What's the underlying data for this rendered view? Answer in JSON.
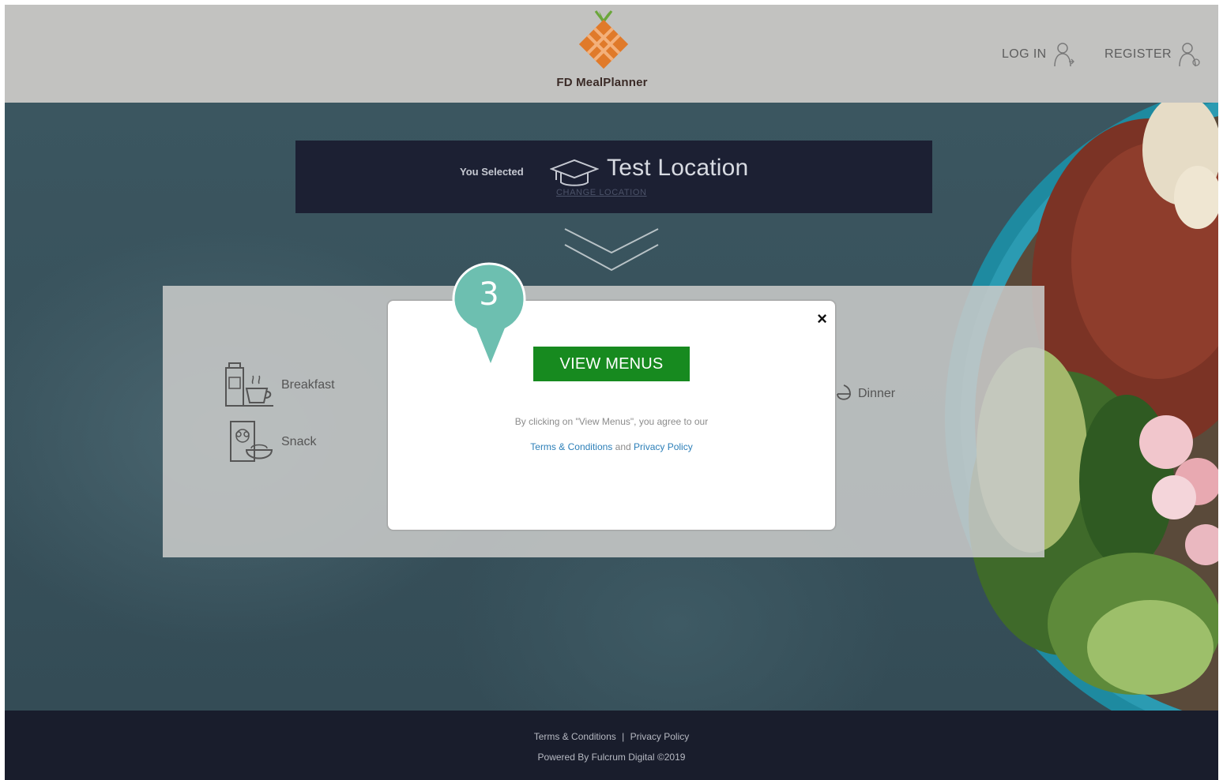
{
  "header": {
    "brand": "FD MealPlanner",
    "login_label": "LOG IN",
    "register_label": "REGISTER"
  },
  "location": {
    "selected_label": "You Selected",
    "name": "Test Location",
    "change_label": "CHANGE LOCATION"
  },
  "meals": {
    "breakfast": "Breakfast",
    "snack": "Snack",
    "dinner": "Dinner"
  },
  "modal": {
    "view_menus_label": "VIEW MENUS",
    "close_glyph": "×",
    "agree_text": "By clicking on \"View Menus\", you agree to our",
    "terms_link": "Terms & Conditions",
    "and_text": "and",
    "privacy_link": "Privacy Policy"
  },
  "marker": {
    "step": "3",
    "color": "#6dbfb0"
  },
  "footer": {
    "terms_link": "Terms & Conditions",
    "separator": "|",
    "privacy_link": "Privacy Policy",
    "powered_by": "Powered By Fulcrum Digital ©2019"
  },
  "colors": {
    "header_bg": "#c2c2c0",
    "location_bar_bg": "#1c2033",
    "footer_bg": "#191d2c",
    "button_green": "#178a1f",
    "link_blue": "#2c7fb8",
    "logo_orange": "#e07a2a"
  },
  "icons": [
    "logo-icon",
    "login-user-icon",
    "register-user-icon",
    "graduation-cap-icon",
    "double-chevron-down-icon",
    "breakfast-icon",
    "snack-icon",
    "dinner-icon",
    "close-icon"
  ]
}
